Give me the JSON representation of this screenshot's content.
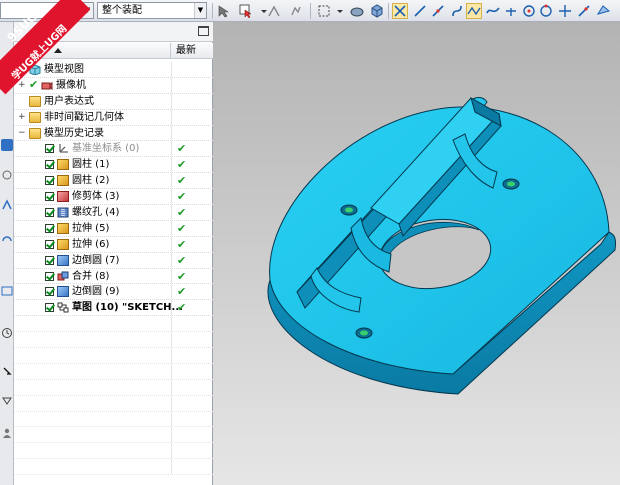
{
  "toolbar": {
    "filter_value": "",
    "assembly_value": "整个装配"
  },
  "watermark": {
    "line1": "9SUG",
    "line2": "学UG就上UG网"
  },
  "navigator": {
    "col_latest": "最新",
    "rows": [
      {
        "label": "模型视图",
        "expander": "+",
        "icon": "model-views-icon"
      },
      {
        "label": "摄像机",
        "expander": "+",
        "icon": "camera-icon"
      },
      {
        "label": "用户表达式",
        "expander": "",
        "icon": "folder-icon"
      },
      {
        "label": "非时间戳记几何体",
        "expander": "+",
        "icon": "folder-icon"
      },
      {
        "label": "模型历史记录",
        "expander": "−",
        "icon": "folder-open-icon"
      },
      {
        "label": "基准坐标系 (0)",
        "icon": "datum-csys-icon",
        "latest": "✔"
      },
      {
        "label": "圆柱 (1)",
        "icon": "cylinder-icon",
        "latest": "✔"
      },
      {
        "label": "圆柱 (2)",
        "icon": "cylinder-icon",
        "latest": "✔"
      },
      {
        "label": "修剪体 (3)",
        "icon": "trim-body-icon",
        "latest": "✔"
      },
      {
        "label": "螺纹孔 (4)",
        "icon": "threaded-hole-icon",
        "latest": "✔"
      },
      {
        "label": "拉伸 (5)",
        "icon": "extrude-icon",
        "latest": "✔"
      },
      {
        "label": "拉伸 (6)",
        "icon": "extrude-icon",
        "latest": "✔"
      },
      {
        "label": "边倒圆 (7)",
        "icon": "edge-blend-icon",
        "latest": "✔"
      },
      {
        "label": "合并 (8)",
        "icon": "unite-icon",
        "latest": "✔"
      },
      {
        "label": "边倒圆 (9)",
        "icon": "edge-blend-icon",
        "latest": "✔"
      },
      {
        "label": "草图 (10) \"SKETCH...",
        "icon": "sketch-icon",
        "latest": "✔"
      }
    ]
  },
  "colors": {
    "model_face": "#1ec3e8",
    "model_side": "#0d8fba",
    "model_edge": "#04384f",
    "check_green": "#1f9a2b",
    "watermark_red": "#e0142d"
  }
}
